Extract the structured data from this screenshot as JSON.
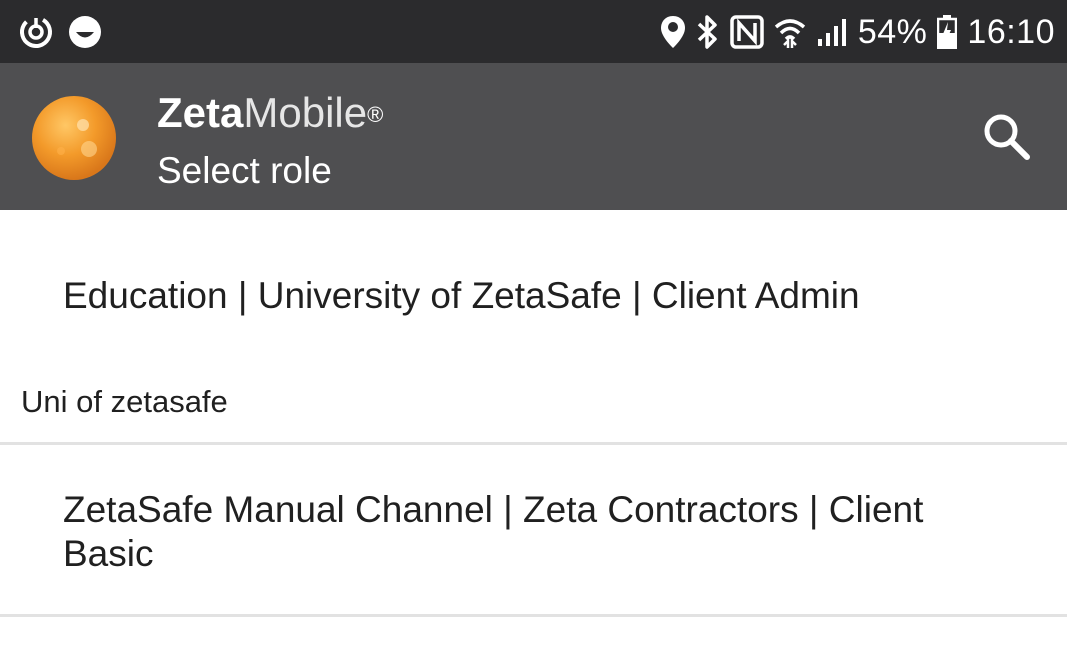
{
  "status_bar": {
    "battery": "54%",
    "time": "16:10",
    "left_icons": [
      "power-saving-icon",
      "smile-icon"
    ],
    "right_icons": [
      "location-pin-icon",
      "bluetooth-icon",
      "nfc-icon",
      "wifi-icon",
      "signal-icon",
      "battery-icon"
    ]
  },
  "app_bar": {
    "brand_bold": "Zeta",
    "brand_light": "Mobile",
    "brand_mark": "®",
    "subtitle": "Select role",
    "search_icon": "search-icon"
  },
  "roles": [
    {
      "label": "Education | University of ZetaSafe | Client Admin",
      "sub": "Uni of zetasafe"
    },
    {
      "label": "ZetaSafe Manual Channel | Zeta Contractors | Client Basic",
      "sub": ""
    }
  ],
  "colors": {
    "status_bar": "#2b2b2d",
    "app_bar": "#4f4f51",
    "logo_orange": "#f39a2a",
    "divider": "#e2e2e2"
  }
}
